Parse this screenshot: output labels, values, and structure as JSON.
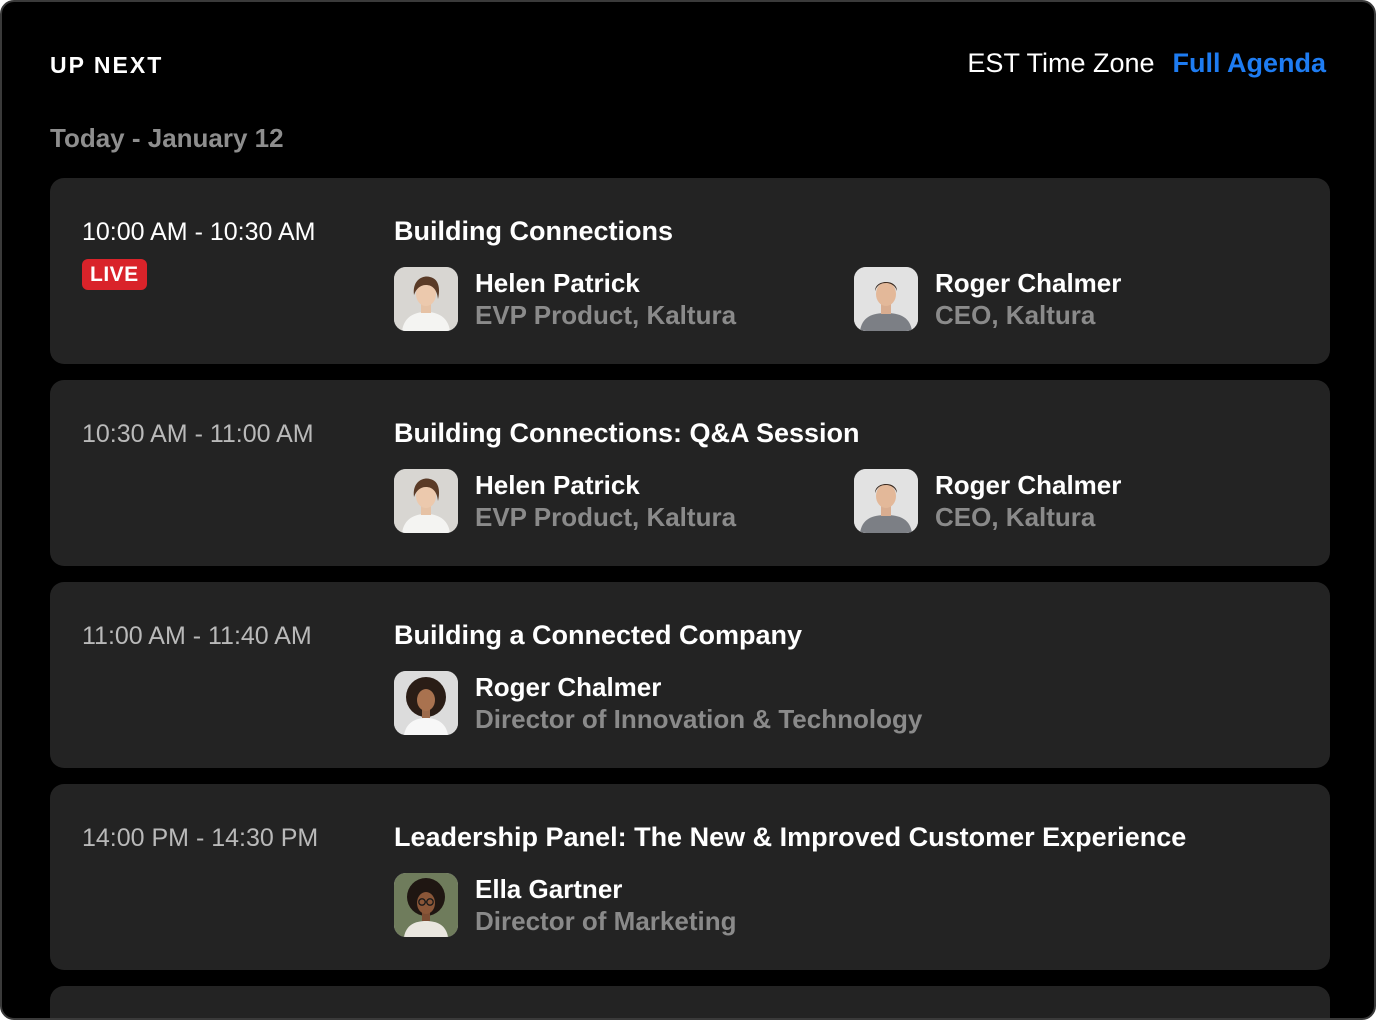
{
  "header": {
    "title": "UP NEXT",
    "timezone": "EST Time Zone",
    "agenda_link": "Full Agenda"
  },
  "date_heading": "Today - January 12",
  "live_label": "LIVE",
  "colors": {
    "background": "#000000",
    "card": "#232323",
    "accent": "#1e7cf2",
    "live": "#d9232a",
    "muted": "#8a8a8a"
  },
  "sessions": [
    {
      "time": "10:00 AM - 10:30 AM",
      "live": true,
      "title": "Building Connections",
      "speakers": [
        {
          "name": "Helen Patrick",
          "role": "EVP Product, Kaltura",
          "icon": "woman-portrait"
        },
        {
          "name": "Roger Chalmer",
          "role": "CEO, Kaltura",
          "icon": "man-portrait"
        }
      ]
    },
    {
      "time": "10:30 AM - 11:00 AM",
      "live": false,
      "title": "Building Connections: Q&A Session",
      "speakers": [
        {
          "name": "Helen Patrick",
          "role": "EVP Product, Kaltura",
          "icon": "woman-portrait"
        },
        {
          "name": "Roger Chalmer",
          "role": "CEO, Kaltura",
          "icon": "man-portrait"
        }
      ]
    },
    {
      "time": "11:00 AM - 11:40 AM",
      "live": false,
      "title": "Building a Connected Company",
      "speakers": [
        {
          "name": "Roger Chalmer",
          "role": "Director of Innovation & Technology",
          "icon": "woman-curly-portrait"
        }
      ]
    },
    {
      "time": "14:00 PM - 14:30 PM",
      "live": false,
      "title": "Leadership Panel: The New & Improved Customer Experience",
      "speakers": [
        {
          "name": "Ella Gartner",
          "role": "Director of Marketing",
          "icon": "woman-glasses-portrait"
        }
      ]
    }
  ]
}
